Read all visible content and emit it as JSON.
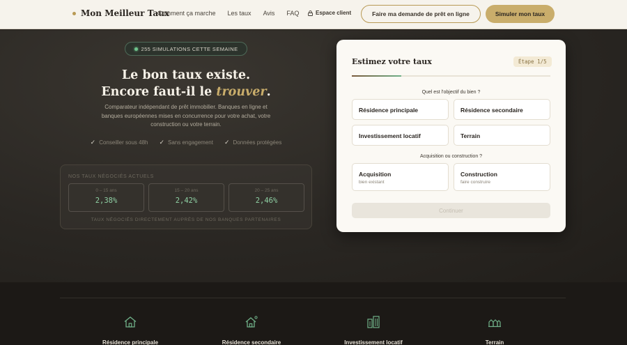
{
  "nav": {
    "brand": "Mon Meilleur Taux",
    "links": [
      "Comment ça marche",
      "Les taux",
      "Avis",
      "FAQ"
    ],
    "espace_client": "Espace client",
    "cta_outline": "Faire ma demande de prêt en ligne",
    "cta_solid": "Simuler mon taux"
  },
  "hero": {
    "badge": "255 SIMULATIONS CETTE SEMAINE",
    "title_line1": "Le bon taux existe.",
    "title_line2_prefix": "Encore faut-il le ",
    "title_highlight": "trouver",
    "title_suffix": ".",
    "subtitle": "Comparateur indépendant de prêt immobilier. Banques en ligne et banques européennes mises en concurrence pour votre achat, votre construction ou votre terrain.",
    "checks": [
      "Conseiller sous 48h",
      "Sans engagement",
      "Données protégées"
    ]
  },
  "rates": {
    "title": "NOS TAUX NÉGOCIÉS ACTUELS",
    "cards": [
      {
        "duration": "0 – 15 ans",
        "value": "2,38%"
      },
      {
        "duration": "15 – 20 ans",
        "value": "2,42%"
      },
      {
        "duration": "20 – 25 ans",
        "value": "2,46%"
      }
    ],
    "footer": "TAUX NÉGOCIÉS DIRECTEMENT AUPRÈS DE NOS BANQUES PARTENAIRES"
  },
  "wizard": {
    "title": "Estimez votre taux",
    "step": "Étape 1/5",
    "progress": 0.25,
    "q1": "Quel est l'objectif du bien ?",
    "opt_residence_principale": "Résidence principale",
    "opt_residence_secondaire": "Résidence secondaire",
    "opt_investissement": "Investissement locatif",
    "opt_terrain": "Terrain",
    "q2": "Acquisition ou construction ?",
    "opt_acquisition": "Acquisition",
    "opt_acquisition_sub": "bien existant",
    "opt_construction": "Construction",
    "opt_construction_sub": "faire construire",
    "continue": "Continuer"
  },
  "bottom": {
    "items": [
      "Résidence principale",
      "Résidence secondaire",
      "Investissement locatif",
      "Terrain"
    ]
  },
  "colors": {
    "accent_gold": "#c9ad6b",
    "accent_green": "#6fb088",
    "dark_bg": "#2a2723"
  }
}
